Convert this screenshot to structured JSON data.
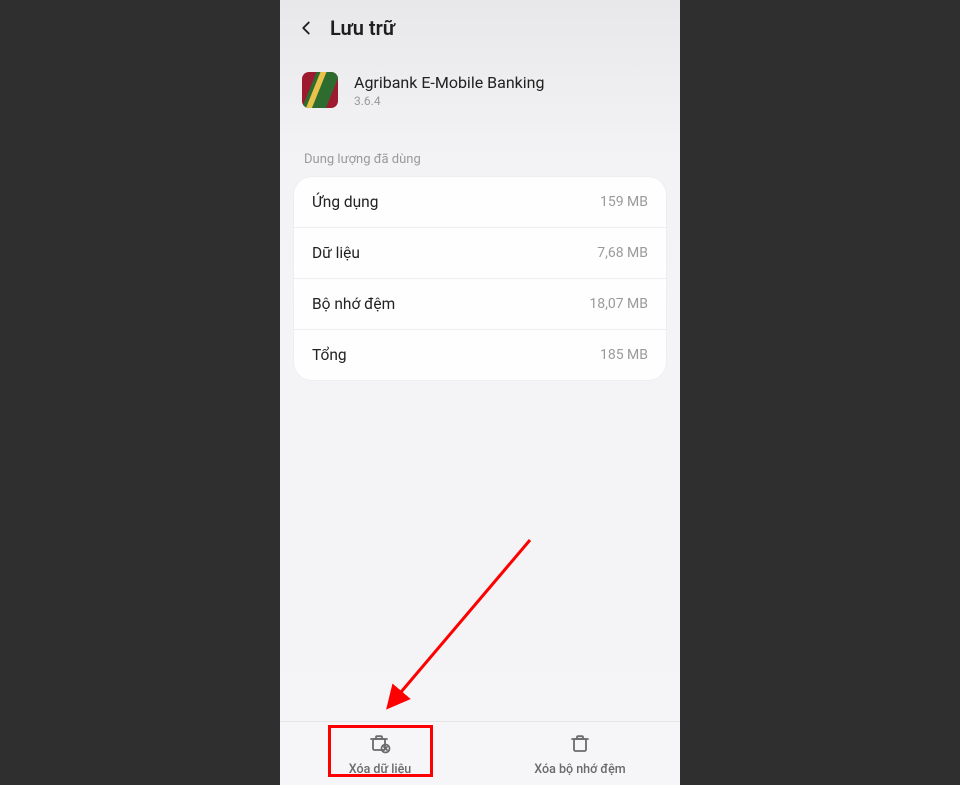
{
  "header": {
    "title": "Lưu trữ"
  },
  "app": {
    "name": "Agribank E-Mobile Banking",
    "version": "3.6.4"
  },
  "section": {
    "used_space_label": "Dung lượng đã dùng"
  },
  "storage": {
    "rows": [
      {
        "label": "Ứng dụng",
        "value": "159 MB"
      },
      {
        "label": "Dữ liệu",
        "value": "7,68 MB"
      },
      {
        "label": "Bộ nhớ đệm",
        "value": "18,07 MB"
      },
      {
        "label": "Tổng",
        "value": "185 MB"
      }
    ]
  },
  "bottom": {
    "clear_data_label": "Xóa dữ liệu",
    "clear_cache_label": "Xóa bộ nhớ đệm"
  }
}
